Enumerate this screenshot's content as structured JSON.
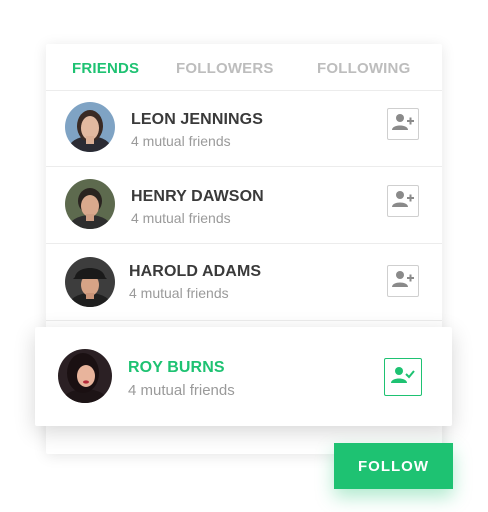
{
  "tabs": [
    {
      "label": "FRIENDS",
      "active": true
    },
    {
      "label": "FOLLOWERS",
      "active": false
    },
    {
      "label": "FOLLOWING",
      "active": false
    }
  ],
  "friends": [
    {
      "name": "LEON JENNINGS",
      "subtitle": "4 mutual friends"
    },
    {
      "name": "HENRY DAWSON",
      "subtitle": "4 mutual friends"
    },
    {
      "name": "HAROLD ADAMS",
      "subtitle": "4 mutual friends"
    }
  ],
  "selected": {
    "name": "ROY BURNS",
    "subtitle": "4 mutual friends"
  },
  "follow_button": {
    "label": "FOLLOW"
  },
  "colors": {
    "accent": "#1ec272",
    "text_dark": "#3a3a3a",
    "text_muted": "#9a9a9a",
    "tab_inactive": "#bdbdbd",
    "border": "#cfcfcf"
  },
  "icons": {
    "add_friend": "person-add-icon",
    "friend_added": "person-check-icon"
  }
}
